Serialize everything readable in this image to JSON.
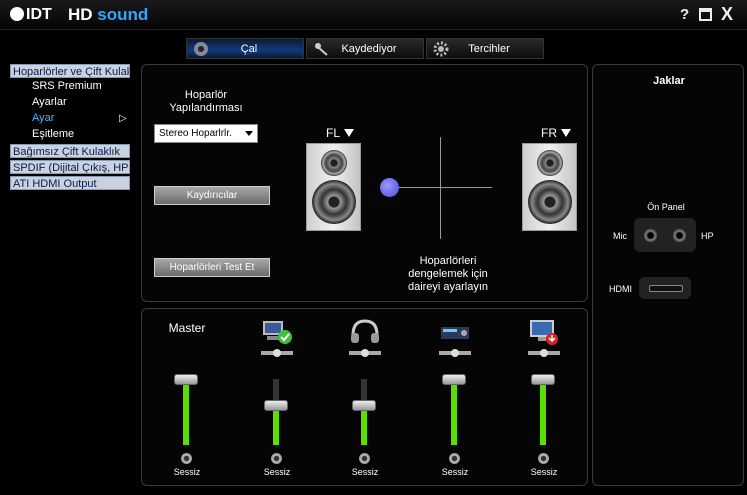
{
  "title": {
    "logo": "IDT",
    "app_name_a": "HD ",
    "app_name_b": "sound",
    "help": "?",
    "close": "X"
  },
  "tabs": [
    {
      "label": "Çal",
      "icon": "speaker-play-icon",
      "active": true
    },
    {
      "label": "Kaydediyor",
      "icon": "microphone-icon",
      "active": false
    },
    {
      "label": "Tercihler",
      "icon": "gear-icon",
      "active": false
    }
  ],
  "sidebar": {
    "items": [
      {
        "label": "Hoparlörler ve Çift Kulaklık",
        "type": "header"
      },
      {
        "label": "SRS Premium",
        "type": "sub"
      },
      {
        "label": "Ayarlar",
        "type": "sub"
      },
      {
        "label": "Ayar",
        "type": "sub",
        "selected": true
      },
      {
        "label": "Eşitleme",
        "type": "sub"
      },
      {
        "label": "Bağımsız Çift Kulaklık",
        "type": "header"
      },
      {
        "label": "SPDIF (Dijital Çıkış, HP Dock)",
        "type": "header"
      },
      {
        "label": "ATI HDMI Output",
        "type": "header"
      }
    ],
    "selected_marker": "▷"
  },
  "config": {
    "heading": "Hoparlör\nYapılandırması",
    "select_value": "Stereo Hoparlrlr.",
    "speakers_button": "Kaydırıcılar",
    "test_button": "Hoparlörleri Test Et",
    "left_channel": "FL",
    "right_channel": "FR",
    "balance_hint": "Hoparlörleri dengelemek için daireyi ayarlayın"
  },
  "mixer": {
    "columns": [
      {
        "caption": "Master",
        "icon": "",
        "level": 1.0,
        "mute_label": "Sessiz"
      },
      {
        "caption": "",
        "icon": "pc-speaker-check-icon",
        "level": 0.6,
        "mute_label": "Sessiz"
      },
      {
        "caption": "",
        "icon": "headphones-icon",
        "level": 0.6,
        "mute_label": "Sessiz"
      },
      {
        "caption": "",
        "icon": "receiver-device-icon",
        "level": 1.0,
        "mute_label": "Sessiz"
      },
      {
        "caption": "",
        "icon": "monitor-down-icon",
        "level": 1.0,
        "mute_label": "Sessiz"
      }
    ],
    "accent": "#59e000"
  },
  "jacks": {
    "title": "Jaklar",
    "front_panel": "Ön Panel",
    "mic": "Mic",
    "hp": "HP",
    "hdmi": "HDMI"
  }
}
